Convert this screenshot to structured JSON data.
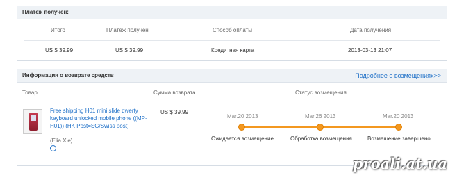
{
  "payment_panel": {
    "title": "Платеж получен:",
    "headers": [
      "Итого",
      "Платёж получен",
      "Способ оплаты",
      "Дата получения"
    ],
    "row": [
      "US $ 39.99",
      "US $ 39.99",
      "Кредитная карта",
      "2013-03-13 21:07"
    ]
  },
  "refund_panel": {
    "title": "Информация о возврате средств",
    "more_link": "Подробнее о возмещениях>>",
    "headers": {
      "product": "Товар",
      "refund_amount": "Сумма возврата",
      "status": "Статус возмещения"
    },
    "product": {
      "title": "Free shipping H01 mini slide qwerty keyboard unlocked mobile phone ((MP-H01)) (HK Post=SG/Swiss post)",
      "seller": "(Elia Xie)",
      "icon": "alarm-clock-icon"
    },
    "amount": "US $ 39.99",
    "timeline": [
      {
        "date": "Mar.20 2013",
        "label": "Ожидается возмещение"
      },
      {
        "date": "Mar.26 2013",
        "label": "Обработка возмещения"
      },
      {
        "date": "Mar.20 2013",
        "label": "Возмещение завершено"
      }
    ],
    "accent_color": "#f39820"
  },
  "watermark": "proali.at.ua"
}
